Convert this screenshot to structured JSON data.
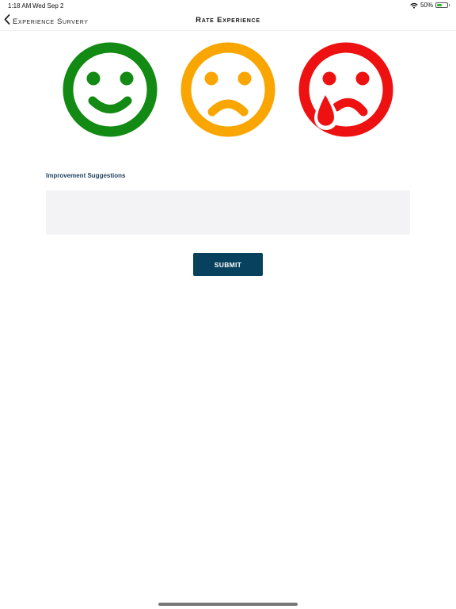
{
  "status_bar": {
    "time": "1:18 AM",
    "date": "Wed Sep 2",
    "battery_text": "50%",
    "battery_level": 0.5,
    "battery_color": "#2eb82e"
  },
  "nav": {
    "back_label": "Experience Survery",
    "back_icon": "chevron-left-icon",
    "title": "Rate Experience"
  },
  "faces": [
    {
      "name": "happy",
      "color": "#138a13"
    },
    {
      "name": "sad",
      "color": "#f9a602"
    },
    {
      "name": "crying",
      "color": "#ee1111"
    }
  ],
  "suggestions": {
    "label": "Improvement Suggestions",
    "value": "",
    "placeholder": ""
  },
  "submit_label": "SUBMIT",
  "colors": {
    "accent": "#07415d",
    "label": "#1d3f5e",
    "input_bg": "#f3f3f5"
  }
}
